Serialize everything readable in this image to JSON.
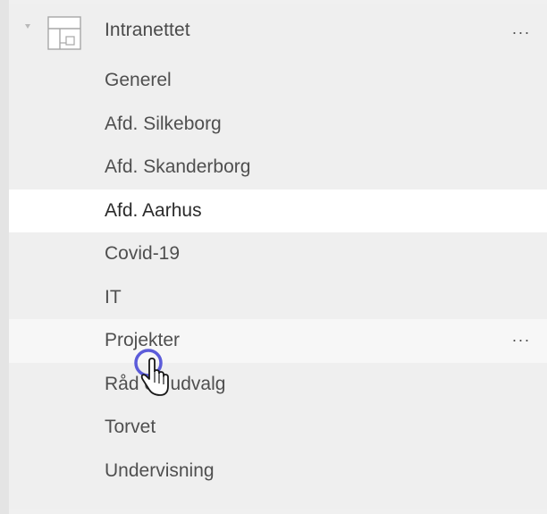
{
  "team": {
    "name": "Intranettet",
    "more_label": "···",
    "avatar_icon": "team-avatar-icon",
    "caret_icon": "chevron-down-icon"
  },
  "channels": [
    {
      "label": "Generel",
      "state": "normal"
    },
    {
      "label": "Afd. Silkeborg",
      "state": "normal"
    },
    {
      "label": "Afd. Skanderborg",
      "state": "normal"
    },
    {
      "label": "Afd. Aarhus",
      "state": "selected"
    },
    {
      "label": "Covid-19",
      "state": "normal"
    },
    {
      "label": "IT",
      "state": "normal"
    },
    {
      "label": "Projekter",
      "state": "hovered",
      "more_label": "···"
    },
    {
      "label": "Råd og udvalg",
      "state": "normal"
    },
    {
      "label": "Torvet",
      "state": "normal"
    },
    {
      "label": "Undervisning",
      "state": "normal"
    }
  ],
  "cursor_icon": "hand-pointer-icon",
  "colors": {
    "background": "#efefef",
    "selected_row": "#ffffff",
    "hover_row": "#f7f7f7",
    "text": "#4f4f4f",
    "cursor_ring": "#4a4ad6"
  }
}
